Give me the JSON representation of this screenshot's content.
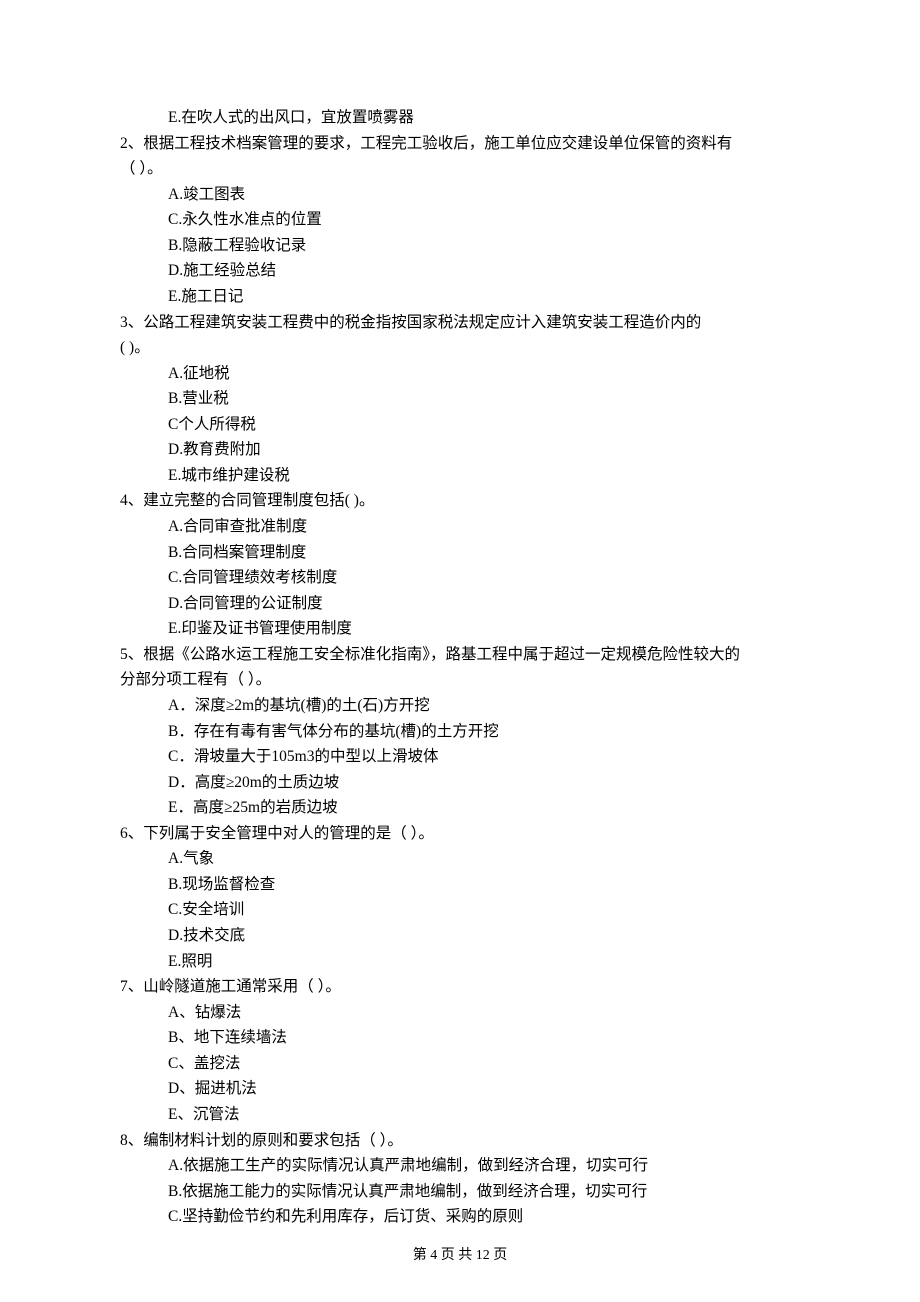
{
  "orphan_option": "E.在吹人式的出风口，宜放置喷雾器",
  "questions": [
    {
      "num": "2、",
      "stem_l1": "根据工程技术档案管理的要求，工程完工验收后，施工单位应交建设单位保管的资料有",
      "stem_l2": "（    ）。",
      "options": [
        "A.竣工图表",
        "C.永久性水准点的位置",
        "B.隐蔽工程验收记录",
        "D.施工经验总结",
        "E.施工日记"
      ]
    },
    {
      "num": "3、",
      "stem_l1": "公路工程建筑安装工程费中的税金指按国家税法规定应计入建筑安装工程造价内的",
      "stem_l2": "(     )。",
      "options": [
        "A.征地税",
        "B.营业税",
        "C个人所得税",
        "D.教育费附加",
        "E.城市维护建设税"
      ]
    },
    {
      "num": "4、",
      "stem_l1": "建立完整的合同管理制度包括(    )。",
      "options": [
        "A.合同审查批准制度",
        "B.合同档案管理制度",
        "C.合同管理绩效考核制度",
        "D.合同管理的公证制度",
        "E.印鉴及证书管理使用制度"
      ]
    },
    {
      "num": "5、",
      "stem_l1": "根据《公路水运工程施工安全标准化指南》，路基工程中属于超过一定规模危险性较大的",
      "stem_l2": "分部分项工程有（    ）。",
      "options": [
        "A．深度≥2m的基坑(槽)的土(石)方开挖",
        "B．存在有毒有害气体分布的基坑(槽)的土方开挖",
        "C．滑坡量大于105m3的中型以上滑坡体",
        "D．高度≥20m的土质边坡",
        "E．高度≥25m的岩质边坡"
      ]
    },
    {
      "num": "6、",
      "stem_l1": "下列属于安全管理中对人的管理的是（    ）。",
      "options": [
        "A.气象",
        "B.现场监督检查",
        "C.安全培训",
        "D.技术交底",
        "E.照明"
      ]
    },
    {
      "num": "7、",
      "stem_l1": "山岭隧道施工通常采用（    ）。",
      "options": [
        "A、钻爆法",
        "B、地下连续墙法",
        "C、盖挖法",
        "D、掘进机法",
        "E、沉管法"
      ]
    },
    {
      "num": "8、",
      "stem_l1": "编制材料计划的原则和要求包括（    ）。",
      "options": [
        "A.依据施工生产的实际情况认真严肃地编制，做到经济合理，切实可行",
        "B.依据施工能力的实际情况认真严肃地编制，做到经济合理，切实可行",
        "C.坚持勤俭节约和先利用库存，后订货、采购的原则"
      ]
    }
  ],
  "footer": "第 4 页 共 12 页"
}
